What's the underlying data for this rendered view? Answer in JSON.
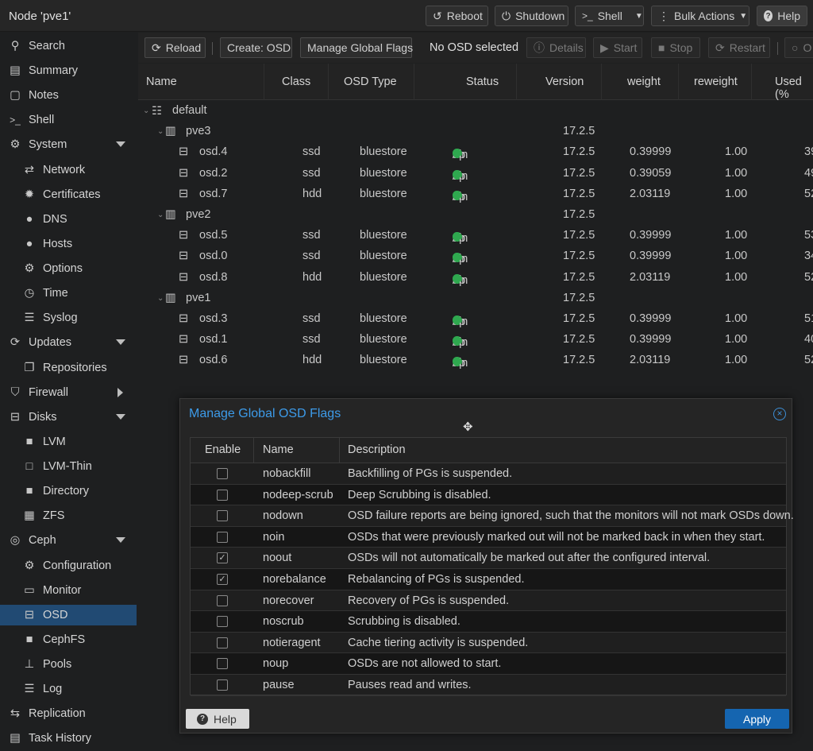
{
  "topbar": {
    "title": "Node 'pve1'",
    "reboot": "Reboot",
    "shutdown": "Shutdown",
    "shell": "Shell",
    "bulk_actions": "Bulk Actions",
    "help": "Help"
  },
  "sidebar": {
    "items": [
      {
        "label": "Search",
        "icon": "search-icon"
      },
      {
        "label": "Summary",
        "icon": "book-icon"
      },
      {
        "label": "Notes",
        "icon": "note-icon"
      },
      {
        "label": "Shell",
        "icon": "terminal-icon"
      },
      {
        "label": "System",
        "icon": "cogs-icon"
      },
      {
        "label": "Network",
        "icon": "exchange-icon"
      },
      {
        "label": "Certificates",
        "icon": "certificate-icon"
      },
      {
        "label": "DNS",
        "icon": "globe-icon"
      },
      {
        "label": "Hosts",
        "icon": "globe-icon"
      },
      {
        "label": "Options",
        "icon": "gear-icon"
      },
      {
        "label": "Time",
        "icon": "clock-icon"
      },
      {
        "label": "Syslog",
        "icon": "list-icon"
      },
      {
        "label": "Updates",
        "icon": "refresh-icon"
      },
      {
        "label": "Repositories",
        "icon": "files-icon"
      },
      {
        "label": "Firewall",
        "icon": "shield-icon"
      },
      {
        "label": "Disks",
        "icon": "hdd-icon"
      },
      {
        "label": "LVM",
        "icon": "square-icon"
      },
      {
        "label": "LVM-Thin",
        "icon": "square-outline-icon"
      },
      {
        "label": "Directory",
        "icon": "folder-icon"
      },
      {
        "label": "ZFS",
        "icon": "grid-icon"
      },
      {
        "label": "Ceph",
        "icon": "ceph-icon"
      },
      {
        "label": "Configuration",
        "icon": "gear-icon"
      },
      {
        "label": "Monitor",
        "icon": "desktop-icon"
      },
      {
        "label": "OSD",
        "icon": "hdd-icon"
      },
      {
        "label": "CephFS",
        "icon": "folder-icon"
      },
      {
        "label": "Pools",
        "icon": "sitemap-icon"
      },
      {
        "label": "Log",
        "icon": "list-icon"
      },
      {
        "label": "Replication",
        "icon": "retweet-icon"
      },
      {
        "label": "Task History",
        "icon": "list-alt-icon"
      }
    ]
  },
  "toolbar": {
    "reload": "Reload",
    "create_osd": "Create: OSD",
    "manage_flags": "Manage Global Flags",
    "no_selection": "No OSD selected",
    "details": "Details",
    "start": "Start",
    "stop": "Stop",
    "restart": "Restart"
  },
  "grid": {
    "headers": {
      "name": "Name",
      "class": "Class",
      "type": "OSD Type",
      "status": "Status",
      "version": "Version",
      "weight": "weight",
      "reweight": "reweight",
      "used": "Used (%"
    },
    "root": "default",
    "hosts": [
      {
        "name": "pve3",
        "version": "17.2.5",
        "osds": [
          {
            "name": "osd.4",
            "class": "ssd",
            "type": "bluestore",
            "version": "17.2.5",
            "weight": "0.39999",
            "reweight": "1.00",
            "used": "39"
          },
          {
            "name": "osd.2",
            "class": "ssd",
            "type": "bluestore",
            "version": "17.2.5",
            "weight": "0.39059",
            "reweight": "1.00",
            "used": "49"
          },
          {
            "name": "osd.7",
            "class": "hdd",
            "type": "bluestore",
            "version": "17.2.5",
            "weight": "2.03119",
            "reweight": "1.00",
            "used": "52"
          }
        ]
      },
      {
        "name": "pve2",
        "version": "17.2.5",
        "osds": [
          {
            "name": "osd.5",
            "class": "ssd",
            "type": "bluestore",
            "version": "17.2.5",
            "weight": "0.39999",
            "reweight": "1.00",
            "used": "53"
          },
          {
            "name": "osd.0",
            "class": "ssd",
            "type": "bluestore",
            "version": "17.2.5",
            "weight": "0.39999",
            "reweight": "1.00",
            "used": "34"
          },
          {
            "name": "osd.8",
            "class": "hdd",
            "type": "bluestore",
            "version": "17.2.5",
            "weight": "2.03119",
            "reweight": "1.00",
            "used": "52"
          }
        ]
      },
      {
        "name": "pve1",
        "version": "17.2.5",
        "osds": [
          {
            "name": "osd.3",
            "class": "ssd",
            "type": "bluestore",
            "version": "17.2.5",
            "weight": "0.39999",
            "reweight": "1.00",
            "used": "51"
          },
          {
            "name": "osd.1",
            "class": "ssd",
            "type": "bluestore",
            "version": "17.2.5",
            "weight": "0.39999",
            "reweight": "1.00",
            "used": "40"
          },
          {
            "name": "osd.6",
            "class": "hdd",
            "type": "bluestore",
            "version": "17.2.5",
            "weight": "2.03119",
            "reweight": "1.00",
            "used": "52"
          }
        ]
      }
    ],
    "status_up": "up",
    "status_sep": "/ in"
  },
  "modal": {
    "title": "Manage Global OSD Flags",
    "headers": {
      "enable": "Enable",
      "name": "Name",
      "description": "Description"
    },
    "flags": [
      {
        "name": "nobackfill",
        "checked": false,
        "description": "Backfilling of PGs is suspended."
      },
      {
        "name": "nodeep-scrub",
        "checked": false,
        "description": "Deep Scrubbing is disabled."
      },
      {
        "name": "nodown",
        "checked": false,
        "description": "OSD failure reports are being ignored, such that the monitors will not mark OSDs down."
      },
      {
        "name": "noin",
        "checked": false,
        "description": "OSDs that were previously marked out will not be marked back in when they start."
      },
      {
        "name": "noout",
        "checked": true,
        "description": "OSDs will not automatically be marked out after the configured interval."
      },
      {
        "name": "norebalance",
        "checked": true,
        "description": "Rebalancing of PGs is suspended."
      },
      {
        "name": "norecover",
        "checked": false,
        "description": "Recovery of PGs is suspended."
      },
      {
        "name": "noscrub",
        "checked": false,
        "description": "Scrubbing is disabled."
      },
      {
        "name": "notieragent",
        "checked": false,
        "description": "Cache tiering activity is suspended."
      },
      {
        "name": "noup",
        "checked": false,
        "description": "OSDs are not allowed to start."
      },
      {
        "name": "pause",
        "checked": false,
        "description": "Pauses read and writes."
      }
    ],
    "help": "Help",
    "apply": "Apply"
  }
}
